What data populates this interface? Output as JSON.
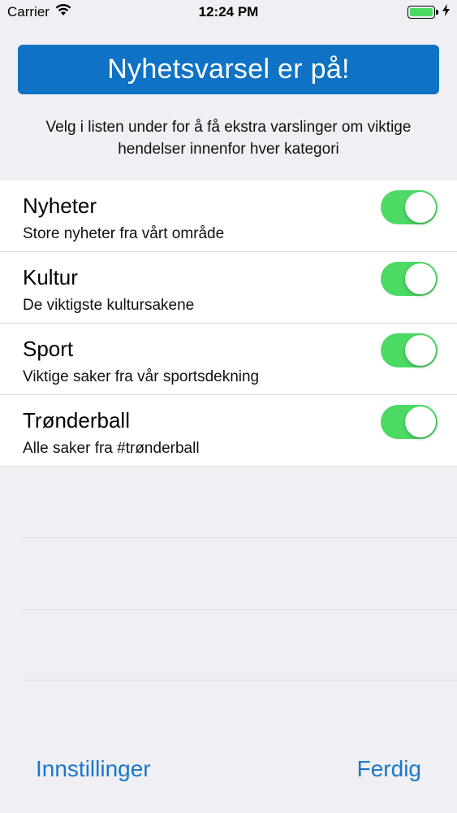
{
  "status_bar": {
    "carrier": "Carrier",
    "time": "12:24 PM",
    "wifi_icon": "wifi-icon",
    "battery_icon": "battery-icon",
    "charging_icon": "charging-bolt-icon",
    "battery_level": 1.0
  },
  "banner": {
    "title": "Nyhetsvarsel er på!",
    "color": "#0f72c4"
  },
  "intro": {
    "text": "Velg i listen under for å få ekstra varslinger om viktige hendelser innenfor hver kategori"
  },
  "categories": [
    {
      "title": "Nyheter",
      "subtitle": "Store nyheter fra vårt område",
      "enabled": true
    },
    {
      "title": "Kultur",
      "subtitle": "De viktigste kultursakene",
      "enabled": true
    },
    {
      "title": "Sport",
      "subtitle": "Viktige saker fra vår sportsdekning",
      "enabled": true
    },
    {
      "title": "Trønderball",
      "subtitle": "Alle saker fra #trønderball",
      "enabled": true
    }
  ],
  "toggle_color": "#4cd964",
  "bottom_bar": {
    "settings_label": "Innstillinger",
    "done_label": "Ferdig",
    "accent_color": "#1a78c8"
  }
}
